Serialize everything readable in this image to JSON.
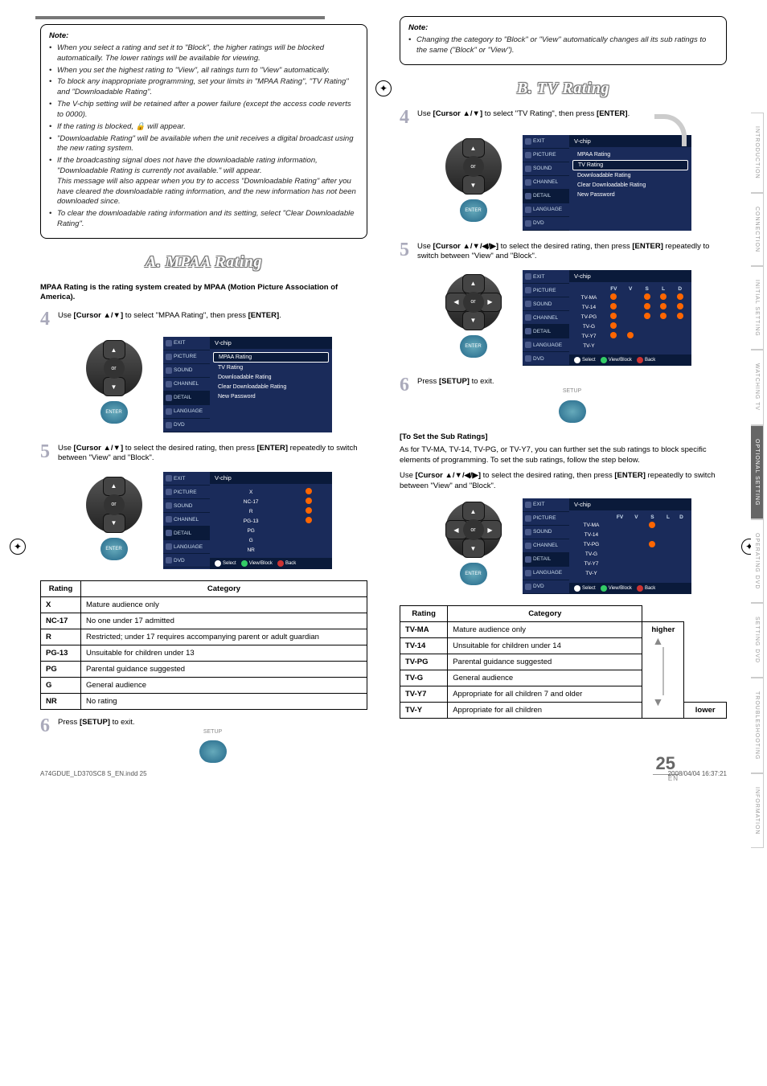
{
  "left": {
    "header_rule": true,
    "note_title": "Note:",
    "notes": [
      "When you select a rating and set it to \"Block\", the higher ratings will be blocked automatically. The lower ratings will be available for viewing.",
      "When you set the highest rating to \"View\", all ratings turn to \"View\" automatically.",
      "To block any inappropriate programming, set your limits in \"MPAA Rating\", \"TV Rating\" and \"Downloadable Rating\".",
      "The V-chip setting will be retained after a power failure (except the access code reverts to 0000).",
      "If the rating is blocked, 🔒 will appear.",
      "\"Downloadable Rating\" will be available when the unit receives a digital broadcast using the new rating system.",
      "If the broadcasting signal does not have the downloadable rating information, \"Downloadable Rating is currently not available.\" will appear.\nThis message will also appear when you try to access \"Downloadable Rating\" after you have cleared the downloadable rating information, and the new information has not been downloaded since.",
      "To clear the downloadable rating information and its setting, select \"Clear Downloadable Rating\"."
    ],
    "section_title": "A. MPAA Rating",
    "subtitle": "MPAA Rating is the rating system created by MPAA (Motion Picture Association of America).",
    "step4_num": "4",
    "step4_pre": "Use ",
    "step4_ctrl": "[Cursor ▲/▼]",
    "step4_mid": " to select \"MPAA Rating\", then press ",
    "step4_btn": "[ENTER]",
    "step4_post": ".",
    "dpad_or": "or",
    "enter_label": "ENTER",
    "osd_sidebar": [
      "EXIT",
      "PICTURE",
      "SOUND",
      "CHANNEL",
      "DETAIL",
      "LANGUAGE",
      "DVD"
    ],
    "osd1_title": "V-chip",
    "osd1_items": [
      "MPAA Rating",
      "TV Rating",
      "Downloadable Rating",
      "Clear Downloadable Rating",
      "New Password"
    ],
    "step5_num": "5",
    "step5_pre": "Use ",
    "step5_ctrl": "[Cursor ▲/▼]",
    "step5_mid": " to select the desired rating, then press ",
    "step5_btn": "[ENTER]",
    "step5_post": " repeatedly to switch between \"View\" and \"Block\".",
    "osd2_title": "V-chip",
    "osd2_rows": [
      "X",
      "NC-17",
      "R",
      "PG-13",
      "PG",
      "G",
      "NR"
    ],
    "osd_footer_select": "Select",
    "osd_footer_vb": "View/Block",
    "osd_footer_back": "Back",
    "table_head_rating": "Rating",
    "table_head_category": "Category",
    "mpaa_rows": [
      {
        "r": "X",
        "c": "Mature audience only"
      },
      {
        "r": "NC-17",
        "c": "No one under 17 admitted"
      },
      {
        "r": "R",
        "c": "Restricted; under 17 requires accompanying parent or adult guardian"
      },
      {
        "r": "PG-13",
        "c": "Unsuitable for children under 13"
      },
      {
        "r": "PG",
        "c": "Parental guidance suggested"
      },
      {
        "r": "G",
        "c": "General audience"
      },
      {
        "r": "NR",
        "c": "No rating"
      }
    ],
    "step6_num": "6",
    "step6_pre": "Press ",
    "step6_btn": "[SETUP]",
    "step6_post": " to exit.",
    "setup_label": "SETUP"
  },
  "right": {
    "note_title": "Note:",
    "notes": [
      "Changing the category to \"Block\" or \"View\" automatically changes all its sub ratings to the same (\"Block\" or \"View\")."
    ],
    "section_title": "B. TV Rating",
    "step4_num": "4",
    "step4_pre": "Use ",
    "step4_ctrl": "[Cursor ▲/▼]",
    "step4_mid": " to select \"TV Rating\", then press ",
    "step4_btn": "[ENTER]",
    "step4_post": ".",
    "dpad_or": "or",
    "enter_label": "ENTER",
    "osd_sidebar": [
      "EXIT",
      "PICTURE",
      "SOUND",
      "CHANNEL",
      "DETAIL",
      "LANGUAGE",
      "DVD"
    ],
    "osd1_title": "V-chip",
    "osd1_items": [
      "MPAA Rating",
      "TV Rating",
      "Downloadable Rating",
      "Clear Downloadable Rating",
      "New Password"
    ],
    "step5_num": "5",
    "step5_pre": "Use ",
    "step5_ctrl": "[Cursor ▲/▼/◀/▶]",
    "step5_mid": " to select the desired rating, then press ",
    "step5_btn": "[ENTER]",
    "step5_post": " repeatedly to switch between \"View\" and \"Block\".",
    "osd2_title": "V-chip",
    "osd2_cols": [
      "",
      "FV",
      "V",
      "S",
      "L",
      "D"
    ],
    "osd2_rows": [
      "TV-MA",
      "TV-14",
      "TV-PG",
      "TV-G",
      "TV-Y7",
      "TV-Y"
    ],
    "osd_footer_select": "Select",
    "osd_footer_vb": "View/Block",
    "osd_footer_back": "Back",
    "step6_num": "6",
    "step6_pre": "Press ",
    "step6_btn": "[SETUP]",
    "step6_post": " to exit.",
    "setup_label": "SETUP",
    "set_sub_heading": "[To Set the Sub Ratings]",
    "sub_body1": "As for TV-MA, TV-14, TV-PG, or TV-Y7, you can further set the sub ratings to block specific elements of programming. To set the sub ratings, follow the step below.",
    "sub_pre": "Use ",
    "sub_ctrl": "[Cursor ▲/▼/◀/▶]",
    "sub_mid": " to select the desired rating, then press ",
    "sub_btn": "[ENTER]",
    "sub_post": " repeatedly to switch between \"View\" and \"Block\".",
    "table_head_rating": "Rating",
    "table_head_category": "Category",
    "tv_rows": [
      {
        "r": "TV-MA",
        "c": "Mature audience only"
      },
      {
        "r": "TV-14",
        "c": "Unsuitable for children under 14"
      },
      {
        "r": "TV-PG",
        "c": "Parental guidance suggested"
      },
      {
        "r": "TV-G",
        "c": "General audience"
      },
      {
        "r": "TV-Y7",
        "c": "Appropriate for all children 7 and older"
      },
      {
        "r": "TV-Y",
        "c": "Appropriate for all children"
      }
    ],
    "higher_label": "higher",
    "lower_label": "lower"
  },
  "tabs": [
    "INTRODUCTION",
    "CONNECTION",
    "INITIAL SETTING",
    "WATCHING TV",
    "OPTIONAL SETTING",
    "OPERATING DVD",
    "SETTING DVD",
    "TROUBLESHOOTING",
    "INFORMATION"
  ],
  "active_tab_index": 4,
  "footer": {
    "page_num": "25",
    "lang": "EN",
    "file_meta": "A74GDUE_LD370SC8 S_EN.indd   25",
    "datetime": "2008/04/04   16:37:21"
  }
}
